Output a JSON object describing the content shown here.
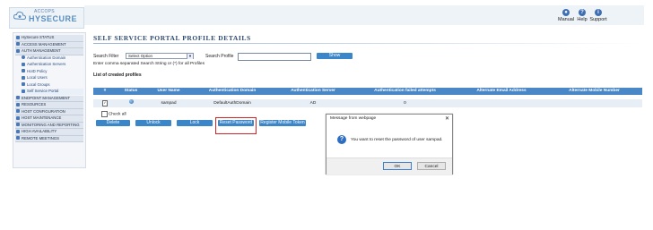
{
  "brand": {
    "line1": "ACCOPS",
    "line2": "HYSECURE"
  },
  "toolbar": {
    "manual": "Manual",
    "help": "Help",
    "support": "Support"
  },
  "sidebar": {
    "items": [
      {
        "label": "HySecure STATUS",
        "level": "top"
      },
      {
        "label": "ACCESS MANAGEMENT",
        "level": "top"
      },
      {
        "label": "AUTH MANAGEMENT",
        "level": "top"
      },
      {
        "label": "Authentication Domain",
        "level": "sub"
      },
      {
        "label": "Authentication Servers",
        "level": "sub"
      },
      {
        "label": "HoID Policy",
        "level": "sub"
      },
      {
        "label": "Local Users",
        "level": "sub"
      },
      {
        "label": "Local Groups",
        "level": "sub"
      },
      {
        "label": "Self Service Portal",
        "level": "sub"
      },
      {
        "label": "ENDPOINT MANAGEMENT",
        "level": "top"
      },
      {
        "label": "RESOURCES",
        "level": "top"
      },
      {
        "label": "HOST CONFIGURATION",
        "level": "top"
      },
      {
        "label": "HOST MAINTENANCE",
        "level": "top"
      },
      {
        "label": "MONITORING AND REPORTING",
        "level": "top"
      },
      {
        "label": "HIGH AVAILABILITY",
        "level": "top"
      },
      {
        "label": "REMOTE MEETINGS",
        "level": "top"
      }
    ]
  },
  "page": {
    "title": "SELF SERVICE PORTAL PROFILE DETAILS",
    "search_filter_label": "Search Filter",
    "search_filter_value": "Select Option",
    "search_profile_label": "Search Profile",
    "search_profile_value": "",
    "show_button": "Show",
    "note": "Enter comma separated Search String or (*) for all Profiles",
    "list_title": "List of created profiles"
  },
  "table": {
    "headers": [
      "#",
      "Status",
      "User Name",
      "Authentication Domain",
      "Authentication Server",
      "Authentication failed attempts",
      "Alternate Email Address",
      "Alternate Mobile Number"
    ],
    "rows": [
      {
        "checked": true,
        "status": "active",
        "user": "sampad",
        "domain": "DefaultAuthDomain",
        "server": "AD",
        "failed": "0",
        "email": "",
        "mobile": ""
      }
    ],
    "check_all": "Check all"
  },
  "actions": {
    "delete": "Delete",
    "unlock": "Unlock",
    "lock": "Lock",
    "reset": "Reset Password",
    "register": "Register Mobile Token"
  },
  "dialog": {
    "title": "Message from webpage",
    "close": "✕",
    "message": "You want to reset the password of user sampad.",
    "ok": "OK",
    "cancel": "Cancel"
  },
  "colors": {
    "accent": "#3b86c8",
    "header": "#4a87c7",
    "highlight": "#d0262a"
  }
}
